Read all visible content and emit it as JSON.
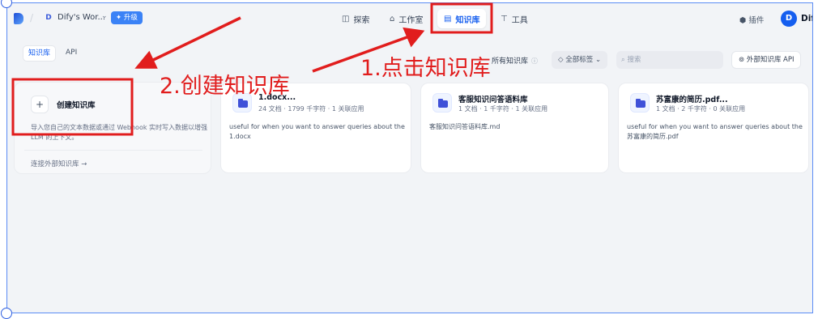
{
  "header": {
    "workspace_initial": "D",
    "workspace_name": "Dify's Wor...",
    "upgrade_label": "✦ 升级",
    "nav": {
      "explore": "探索",
      "studio": "工作室",
      "knowledge": "知识库",
      "tools": "工具"
    },
    "plugins_label": "插件",
    "user_initial": "D",
    "user_name": "Dify"
  },
  "subheader": {
    "tabs": [
      "知识库",
      "API"
    ],
    "all_kb_label": "所有知识库",
    "tag_filter_label": "全部标签",
    "search_placeholder": "搜索",
    "external_api_label": "外部知识库 API"
  },
  "create_card": {
    "plus": "+",
    "title": "创建知识库",
    "description": "导入您自己的文本数据或通过 Webhook 实时写入数据以增强 LLM 的上下文。",
    "external_link": "连接外部知识库 →"
  },
  "knowledge_bases": [
    {
      "name": "1.docx...",
      "meta": "24 文档 · 1799 千字符 · 1 关联应用",
      "description": "useful for when you want to answer queries about the 1.docx"
    },
    {
      "name": "客服知识问答语料库",
      "meta": "1 文档 · 1 千字符 · 1 关联应用",
      "description": "客服知识问答语料库.md"
    },
    {
      "name": "苏富康的简历.pdf...",
      "meta": "1 文档 · 2 千字符 · 0 关联应用",
      "description": "useful for when you want to answer queries about the 苏富康的简历.pdf"
    }
  ],
  "annotations": {
    "step1": "1.点击知识库",
    "step2": "2.创建知识库",
    "color": "#e11d1d"
  },
  "colors": {
    "accent": "#155eef",
    "page_bg": "#f2f4f7"
  }
}
